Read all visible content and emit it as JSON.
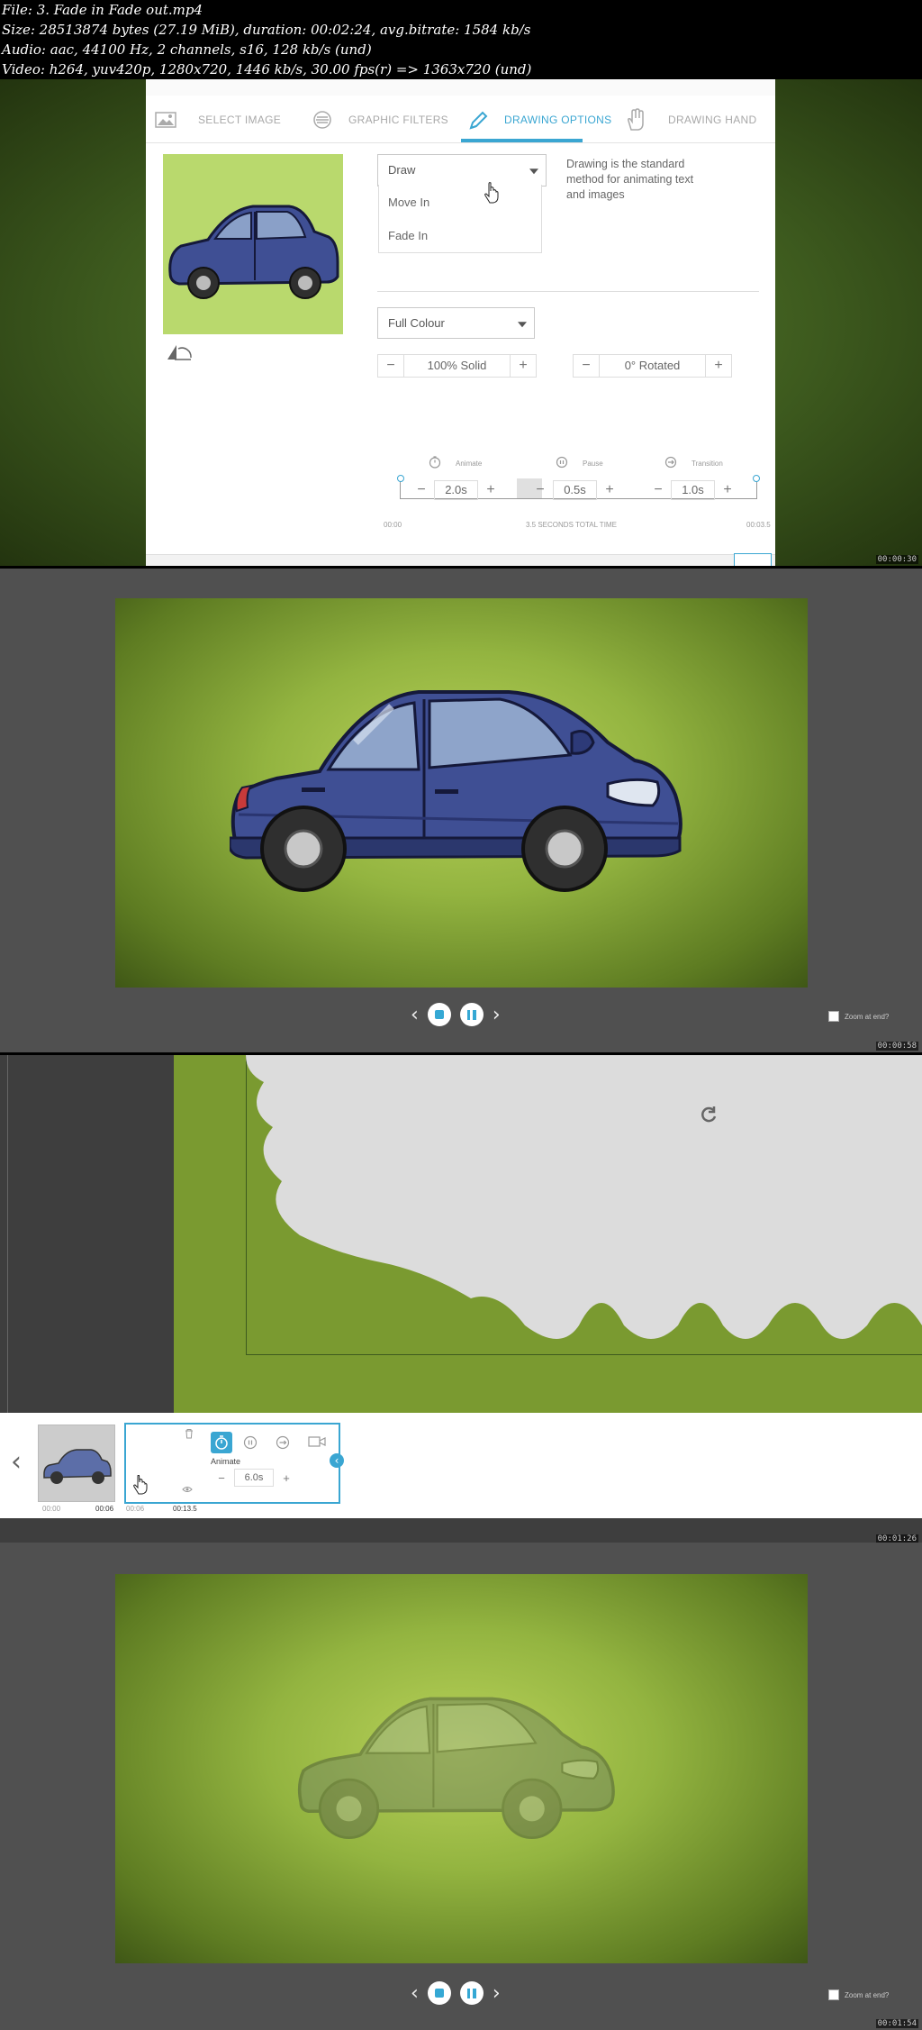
{
  "header": {
    "line1": "File: 3. Fade in Fade out.mp4",
    "line2": "Size: 28513874 bytes (27.19 MiB), duration: 00:02:24, avg.bitrate: 1584 kb/s",
    "line3": "Audio: aac, 44100 Hz, 2 channels, s16, 128 kb/s (und)",
    "line4": "Video: h264, yuv420p, 1280x720, 1446 kb/s, 30.00 fps(r) => 1363x720 (und)"
  },
  "frame1": {
    "tabs": [
      {
        "label": "SELECT IMAGE",
        "icon": "image-icon"
      },
      {
        "label": "GRAPHIC FILTERS",
        "icon": "filters-icon"
      },
      {
        "label": "DRAWING OPTIONS",
        "icon": "pencil-icon",
        "active": true
      },
      {
        "label": "DRAWING HAND",
        "icon": "hand-icon"
      }
    ],
    "draw_select": "Draw",
    "draw_options": [
      "Move In",
      "Fade In"
    ],
    "description": "Drawing is the standard method for animating text and images",
    "colour_select": "Full Colour",
    "opacity_value": "100% Solid",
    "rotation_value": "0° Rotated",
    "animate_label": "Animate",
    "animate_value": "2.0s",
    "pause_label": "Pause",
    "pause_value": "0.5s",
    "transition_label": "Transition",
    "transition_value": "1.0s",
    "time_start": "00:00",
    "total_time": "3.5 SECONDS TOTAL TIME",
    "time_end": "00:03.5",
    "timestamp": "00:00:30",
    "accent": "#3aa6d2"
  },
  "frame2": {
    "zoom_label": "Zoom at end?",
    "timestamp": "00:00:58"
  },
  "frame3": {
    "animate_label": "Animate",
    "animate_value": "6.0s",
    "thumb1_start": "00:00",
    "thumb1_end": "00:06",
    "thumb2_start": "00:06",
    "thumb2_end": "00:13.5",
    "timestamp": "00:01:26"
  },
  "frame4": {
    "zoom_label": "Zoom at end?",
    "timestamp": "00:01:54"
  },
  "colors": {
    "car_body": "#3f4f94",
    "car_dark": "#1f2a5a",
    "stage_green": "#93b440",
    "thumb_green": "#b9d96d"
  }
}
